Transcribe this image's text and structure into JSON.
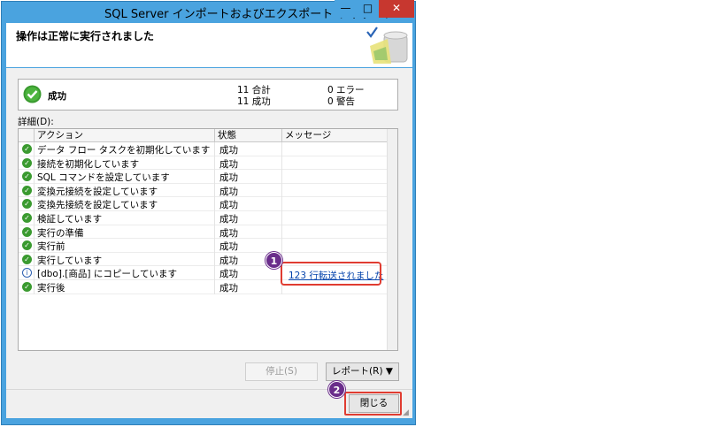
{
  "window": {
    "title": "SQL Server インポートおよびエクスポート ウィザード",
    "minimize_glyph": "—",
    "maximize_glyph": "□",
    "close_glyph": "✕"
  },
  "header": {
    "title": "操作は正常に実行されました",
    "logo_icon": "checkmark-drive-icon"
  },
  "summary": {
    "status_icon": "success-check-icon",
    "status": "成功",
    "total_count": "11 合計",
    "success_count": "11 成功",
    "error_count": "0 エラー",
    "warning_count": "0 警告"
  },
  "details": {
    "label": "詳細(D):",
    "columns": [
      "アクション",
      "状態",
      "メッセージ"
    ],
    "rows": [
      {
        "icon": "success-check-icon",
        "action": "データ フロー タスクを初期化しています",
        "status": "成功",
        "message": ""
      },
      {
        "icon": "success-check-icon",
        "action": "接続を初期化しています",
        "status": "成功",
        "message": ""
      },
      {
        "icon": "success-check-icon",
        "action": "SQL コマンドを設定しています",
        "status": "成功",
        "message": ""
      },
      {
        "icon": "success-check-icon",
        "action": "変換元接続を設定しています",
        "status": "成功",
        "message": ""
      },
      {
        "icon": "success-check-icon",
        "action": "変換先接続を設定しています",
        "status": "成功",
        "message": ""
      },
      {
        "icon": "success-check-icon",
        "action": "検証しています",
        "status": "成功",
        "message": ""
      },
      {
        "icon": "success-check-icon",
        "action": "実行の準備",
        "status": "成功",
        "message": ""
      },
      {
        "icon": "success-check-icon",
        "action": "実行前",
        "status": "成功",
        "message": ""
      },
      {
        "icon": "success-check-icon",
        "action": "実行しています",
        "status": "成功",
        "message": ""
      },
      {
        "icon": "info-icon",
        "action": "[dbo].[商品] にコピーしています",
        "status": "成功",
        "message": "123 行転送されました"
      },
      {
        "icon": "success-check-icon",
        "action": "実行後",
        "status": "成功",
        "message": ""
      }
    ]
  },
  "buttons": {
    "stop": "停止(S)",
    "report": "レポート(R) ▼",
    "close": "閉じる"
  },
  "callouts": {
    "one": "1",
    "two": "2"
  },
  "colors": {
    "titlebar": "#4aa3df",
    "close_button": "#c7372f",
    "success_green": "#3a9a2f",
    "callout_badge": "#6a2d8b",
    "callout_border": "#e03c31",
    "link": "#0645ad"
  }
}
